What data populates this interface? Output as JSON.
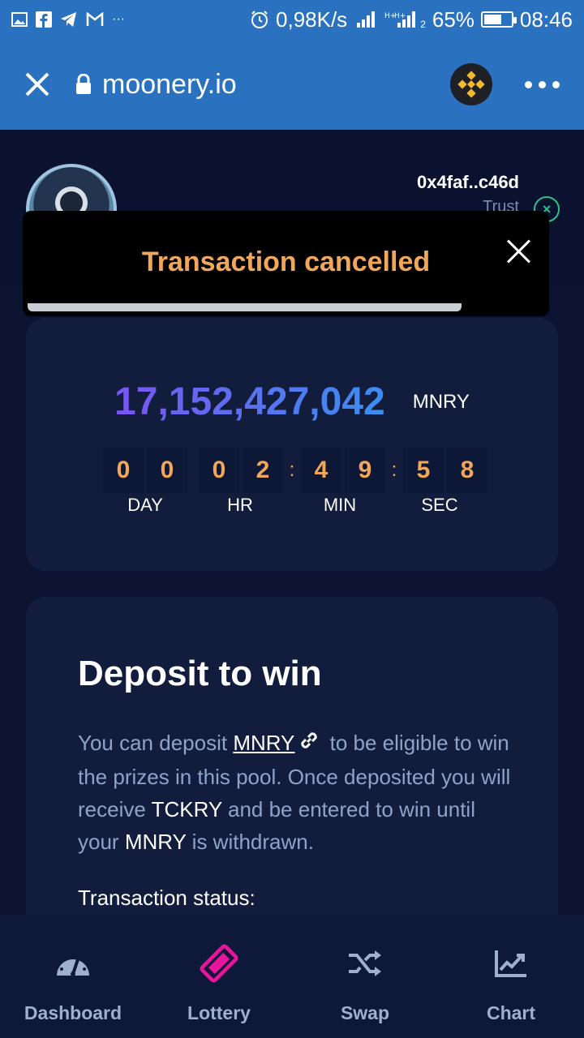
{
  "status_bar": {
    "left_icons": [
      "gallery-icon",
      "facebook-icon",
      "telegram-icon",
      "gmail-icon",
      "more-icon"
    ],
    "network_speed": "0,98K/s",
    "signal_label": "2",
    "battery": "65%",
    "battery_level": 0.65,
    "time": "08:46"
  },
  "browser": {
    "url": "moonery.io"
  },
  "header": {
    "wallet_address": "0x4faf..c46d",
    "trust_label": "Trust"
  },
  "toast": {
    "message": "Transaction cancelled",
    "progress": 0.84
  },
  "prize": {
    "amount": "17,152,427,042",
    "unit": "MNRY",
    "countdown": {
      "day": [
        "0",
        "0"
      ],
      "hr": [
        "0",
        "2"
      ],
      "min": [
        "4",
        "9"
      ],
      "sec": [
        "5",
        "8"
      ]
    },
    "labels": {
      "day": "DAY",
      "hr": "HR",
      "min": "MIN",
      "sec": "SEC"
    }
  },
  "deposit": {
    "title": "Deposit to win",
    "text_1": "You can deposit ",
    "token_link": "MNRY",
    "text_2": " to be eligible to win the prizes in this pool. Once deposited you will receive ",
    "ticket_token": "TCKRY",
    "text_3": " and be entered to win until your ",
    "token_2": "MNRY",
    "text_4": " is withdrawn.",
    "tx_status_label": "Transaction status:"
  },
  "nav": [
    {
      "label": "Dashboard",
      "icon": "gauge-icon",
      "color": "#9fb0cc"
    },
    {
      "label": "Lottery",
      "icon": "ticket-icon",
      "color": "#e6169a"
    },
    {
      "label": "Swap",
      "icon": "shuffle-icon",
      "color": "#9fb0cc"
    },
    {
      "label": "Chart",
      "icon": "chart-icon",
      "color": "#9fb0cc"
    }
  ],
  "colors": {
    "accent_orange": "#f0a75a",
    "lottery_pink": "#e6169a",
    "browser_blue": "#2a72bf"
  }
}
